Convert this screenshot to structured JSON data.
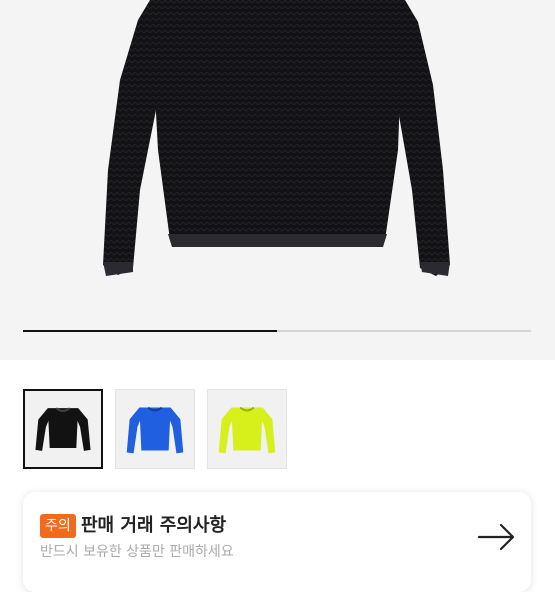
{
  "gallery": {
    "image_description": "black knit sweater",
    "progress_fraction": 0.5,
    "thumbnails": [
      {
        "name": "black-sweater",
        "color": "#121212",
        "selected": true
      },
      {
        "name": "blue-sweater",
        "color": "#1f5fe0",
        "selected": false
      },
      {
        "name": "lime-sweater",
        "color": "#d6f01c",
        "selected": false
      }
    ]
  },
  "notice": {
    "badge": "주의",
    "title": "판매 거래 주의사항",
    "subtitle": "반드시 보유한 상품만 판매하세요",
    "arrow_icon": "arrow-right-icon"
  },
  "colors": {
    "accent": "#f26b1d"
  }
}
